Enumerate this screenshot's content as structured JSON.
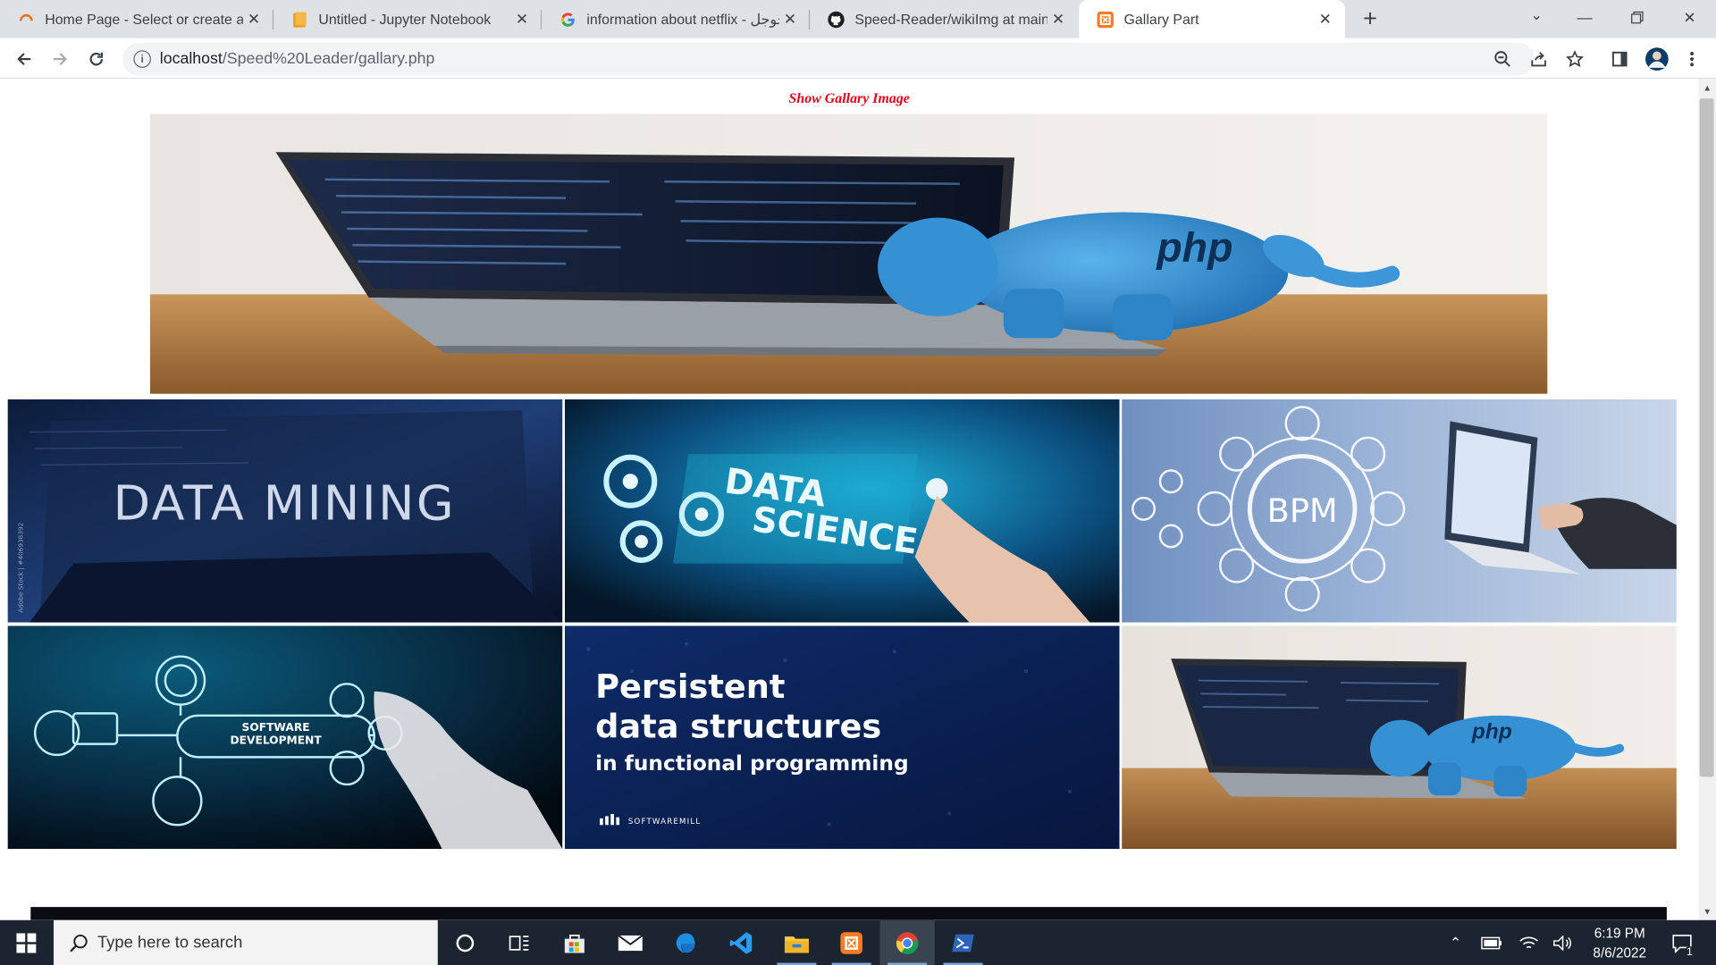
{
  "browser": {
    "tabs": [
      {
        "title": "Home Page - Select or create a n",
        "icon": "loading-spinner-icon"
      },
      {
        "title": "Untitled - Jupyter Notebook",
        "icon": "jupyter-icon"
      },
      {
        "title": "information about netflix - بحث جوجل",
        "icon": "google-icon"
      },
      {
        "title": "Speed-Reader/wikiImg at main · G",
        "icon": "github-icon"
      },
      {
        "title": "Gallary Part",
        "icon": "xampp-icon",
        "active": true
      }
    ],
    "address": {
      "host": "localhost",
      "path": "/Speed%20Leader/gallary.php"
    }
  },
  "page": {
    "heading": "Show Gallary Image",
    "hero": {
      "caption": "php"
    },
    "gallery": [
      {
        "title": "DATA MINING",
        "watermark": "Adobe Stock | #406938392"
      },
      {
        "title_line1": "DATA",
        "title_line2": "SCIENCE"
      },
      {
        "title": "BPM"
      },
      {
        "title_line1": "SOFTWARE",
        "title_line2": "DEVELOPMENT"
      },
      {
        "title_line1": "Persistent",
        "title_line2": "data structures",
        "title_line3": "in functional programming",
        "brand": "SOFTWAREMILL"
      },
      {
        "caption": "php"
      }
    ]
  },
  "taskbar": {
    "search_placeholder": "Type here to search",
    "time": "6:19 PM",
    "date": "8/6/2022",
    "notification_count": "1"
  }
}
